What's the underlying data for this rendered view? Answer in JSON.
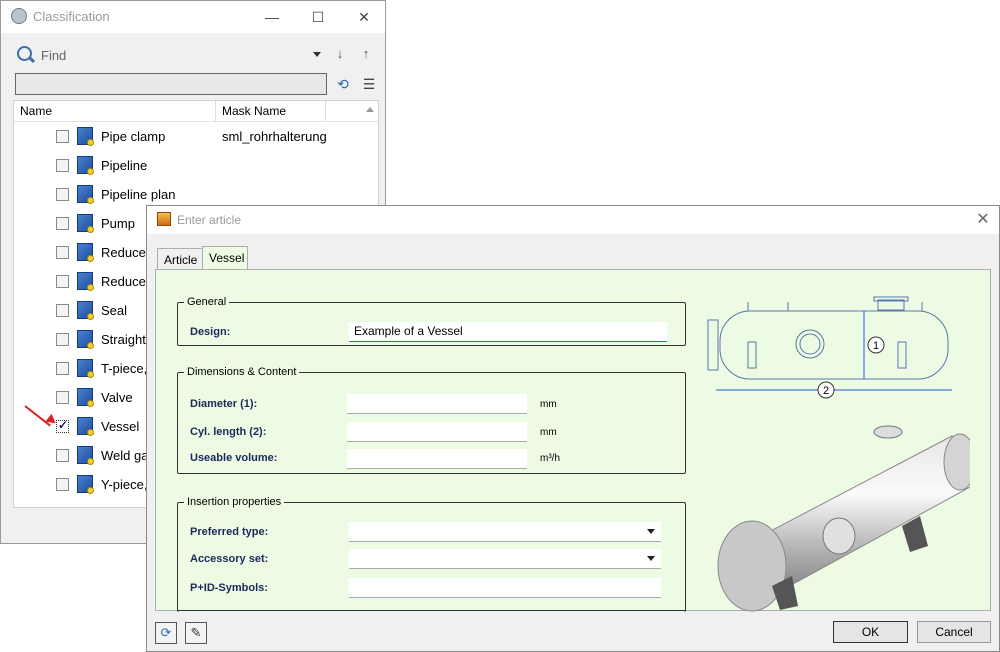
{
  "classification_window": {
    "title": "Classification",
    "controls": {
      "minimize": "—",
      "maximize": "☐",
      "close": "✕"
    },
    "find": {
      "placeholder": "Find"
    },
    "filter_value": "",
    "columns": [
      "Name",
      "Mask Name"
    ],
    "items": [
      {
        "name": "Pipe clamp",
        "mask": "sml_rohrhalterung",
        "checked": false
      },
      {
        "name": "Pipeline",
        "mask": "",
        "checked": false
      },
      {
        "name": "Pipeline plan",
        "mask": "",
        "checked": false
      },
      {
        "name": "Pump",
        "mask": "",
        "checked": false
      },
      {
        "name": "Reducer,",
        "mask": "",
        "checked": false
      },
      {
        "name": "Reducer,",
        "mask": "",
        "checked": false
      },
      {
        "name": "Seal",
        "mask": "",
        "checked": false
      },
      {
        "name": "Straight p",
        "mask": "",
        "checked": false
      },
      {
        "name": "T-piece,",
        "mask": "",
        "checked": false
      },
      {
        "name": "Valve",
        "mask": "",
        "checked": false
      },
      {
        "name": "Vessel",
        "mask": "",
        "checked": true
      },
      {
        "name": "Weld gap",
        "mask": "",
        "checked": false
      },
      {
        "name": "Y-piece,",
        "mask": "",
        "checked": false
      }
    ]
  },
  "enter_article": {
    "title": "Enter article",
    "close": "✕",
    "tabs": [
      "Article",
      "Vessel"
    ],
    "active_tab": "Vessel",
    "general": {
      "legend": "General",
      "design_label": "Design:",
      "design_value": "Example of a Vessel"
    },
    "dimensions": {
      "legend": "Dimensions & Content",
      "diameter_label": "Diameter (1):",
      "diameter_unit": "mm",
      "cyl_length_label": "Cyl. length (2):",
      "cyl_length_unit": "mm",
      "volume_label": "Useable volume:",
      "volume_unit": "m³/h"
    },
    "insertion": {
      "legend": "Insertion properties",
      "preferred_type_label": "Preferred type:",
      "accessory_set_label": "Accessory set:",
      "pid_symbols_label": "P+ID-Symbols:"
    },
    "drawing_labels": {
      "dim1": "1",
      "dim2": "2"
    },
    "buttons": {
      "ok": "OK",
      "cancel": "Cancel"
    },
    "icons": {
      "refresh": "refresh-icon",
      "eraser": "eraser-icon"
    }
  }
}
